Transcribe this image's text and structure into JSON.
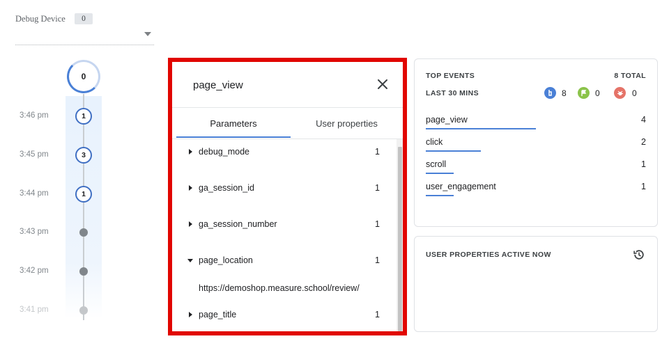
{
  "debug_device": {
    "label": "Debug Device",
    "count": "0"
  },
  "timeline": {
    "top_count": "0",
    "rows": [
      {
        "time": "3:46 pm",
        "count": "1"
      },
      {
        "time": "3:45 pm",
        "count": "3"
      },
      {
        "time": "3:44 pm",
        "count": "1"
      },
      {
        "time": "3:43 pm",
        "count": ""
      },
      {
        "time": "3:42 pm",
        "count": ""
      },
      {
        "time": "3:41 pm",
        "count": ""
      }
    ]
  },
  "event_panel": {
    "title": "page_view",
    "close_icon": "close-icon",
    "tabs": [
      {
        "label": "Parameters",
        "active": true
      },
      {
        "label": "User properties",
        "active": false
      }
    ],
    "parameters": [
      {
        "name": "debug_mode",
        "count": "1",
        "expanded": false
      },
      {
        "name": "ga_session_id",
        "count": "1",
        "expanded": false
      },
      {
        "name": "ga_session_number",
        "count": "1",
        "expanded": false
      },
      {
        "name": "page_location",
        "count": "1",
        "expanded": true,
        "value": "https://demoshop.measure.school/review/"
      },
      {
        "name": "page_title",
        "count": "1",
        "expanded": false
      }
    ],
    "highlight_color": "#e10600"
  },
  "top_events": {
    "title": "TOP EVENTS",
    "total": "8 TOTAL",
    "range": "LAST 30 MINS",
    "counters": [
      {
        "icon": "event-icon",
        "color": "#4a80d6",
        "value": "8"
      },
      {
        "icon": "conversion-flag-icon",
        "color": "#8bc34a",
        "value": "0"
      },
      {
        "icon": "error-bug-icon",
        "color": "#e57368",
        "value": "0"
      }
    ],
    "events": [
      {
        "name": "page_view",
        "count": "4",
        "share": 0.5
      },
      {
        "name": "click",
        "count": "2",
        "share": 0.25
      },
      {
        "name": "scroll",
        "count": "1",
        "share": 0.125
      },
      {
        "name": "user_engagement",
        "count": "1",
        "share": 0.125
      }
    ],
    "accent_color": "#4a80d6"
  },
  "user_properties": {
    "title": "USER PROPERTIES ACTIVE NOW",
    "icon": "history-icon"
  }
}
